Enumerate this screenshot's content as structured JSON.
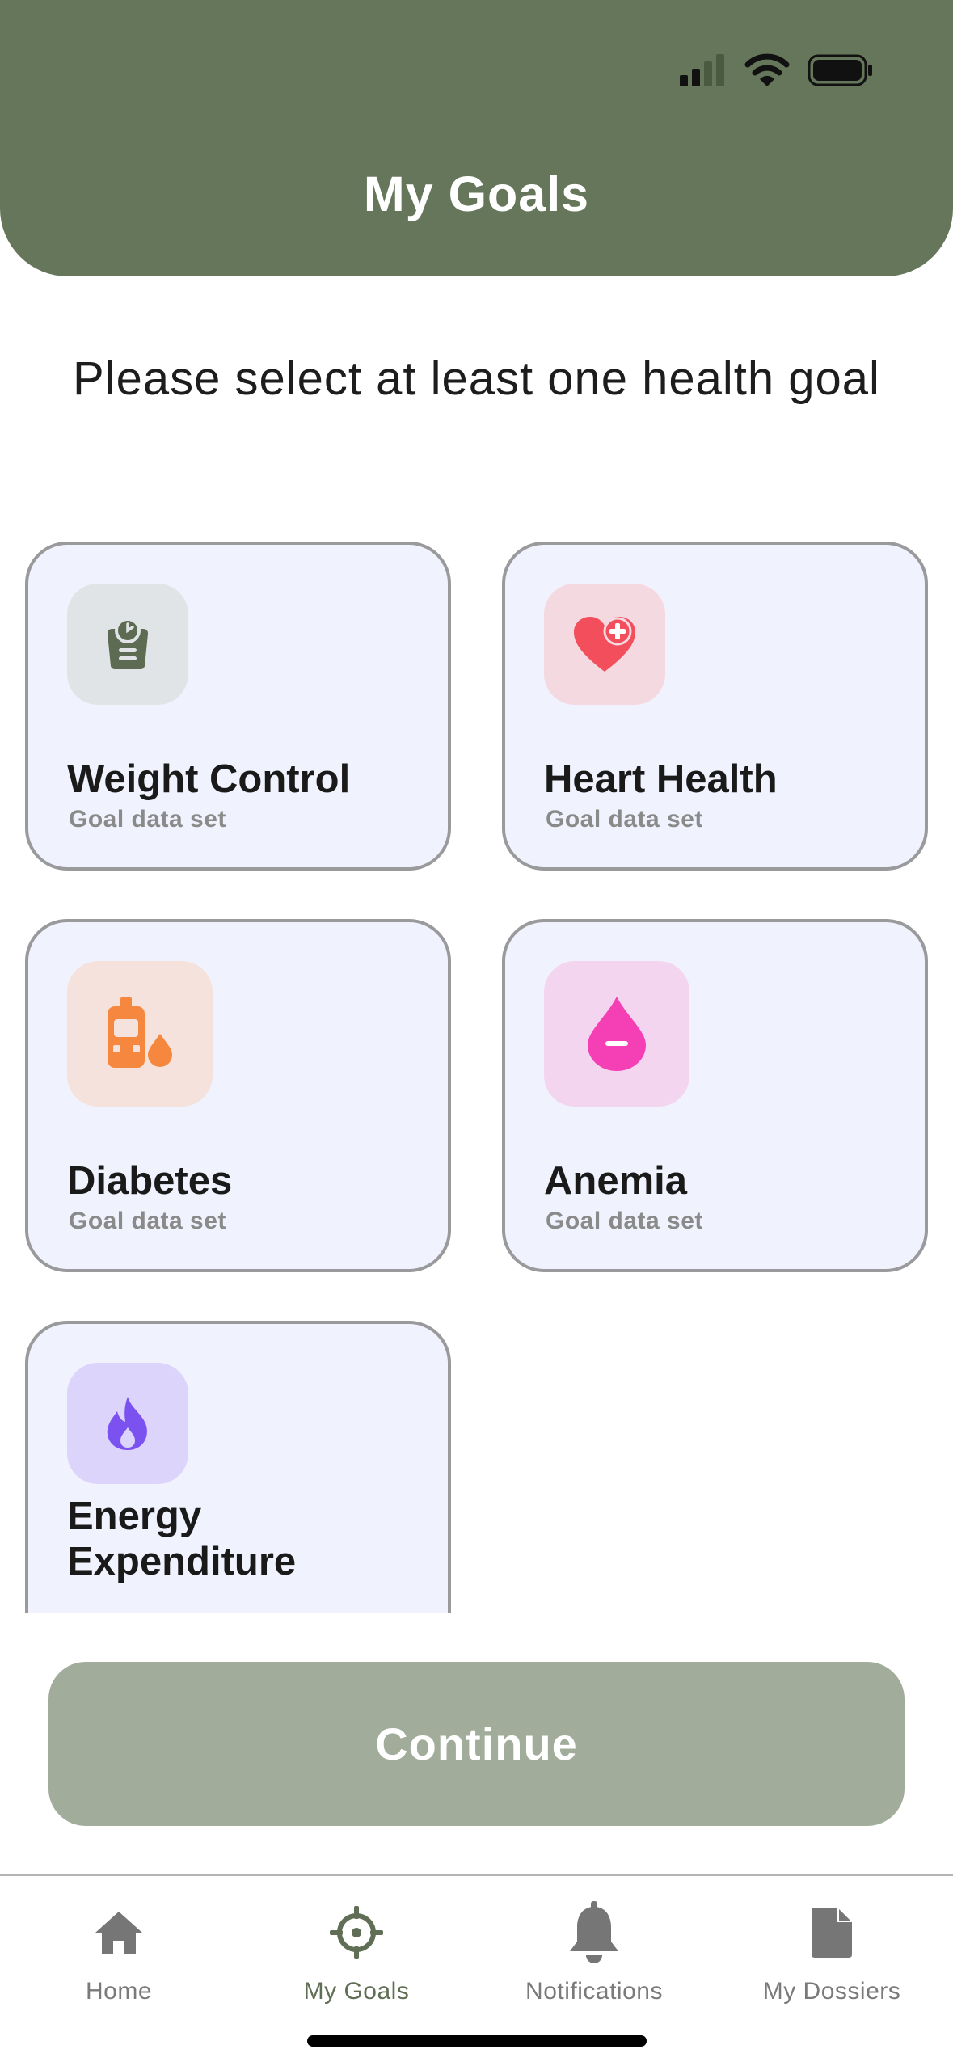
{
  "header": {
    "title": "My Goals"
  },
  "prompt": "Please select at least one health goal",
  "goals": [
    {
      "title": "Weight Control",
      "subtitle": "Goal data set",
      "icon": "scale-icon"
    },
    {
      "title": "Heart Health",
      "subtitle": "Goal data set",
      "icon": "heart-plus-icon"
    },
    {
      "title": "Diabetes",
      "subtitle": "Goal data set",
      "icon": "glucose-meter-icon"
    },
    {
      "title": "Anemia",
      "subtitle": "Goal data set",
      "icon": "blood-drop-minus-icon"
    },
    {
      "title_line1": "Energy",
      "title_line2": "Expenditure",
      "icon": "flame-icon"
    }
  ],
  "continue_label": "Continue",
  "tabs": [
    {
      "label": "Home",
      "icon": "home-icon",
      "active": false
    },
    {
      "label": "My Goals",
      "icon": "crosshair-icon",
      "active": true
    },
    {
      "label": "Notifications",
      "icon": "bell-icon",
      "active": false
    },
    {
      "label": "My Dossiers",
      "icon": "document-icon",
      "active": false
    }
  ],
  "colors": {
    "header": "#66765a",
    "card_bg": "#f0f3fe",
    "card_border": "#9a9a9d",
    "continue_disabled": "#a2ac9a",
    "active_tab": "#5f6e54",
    "weight_icon": "#5d6b52",
    "heart_icon": "#f24e5c",
    "diabetes_icon": "#f6873e",
    "anemia_icon": "#f43fb5",
    "energy_icon": "#7b52f0"
  }
}
